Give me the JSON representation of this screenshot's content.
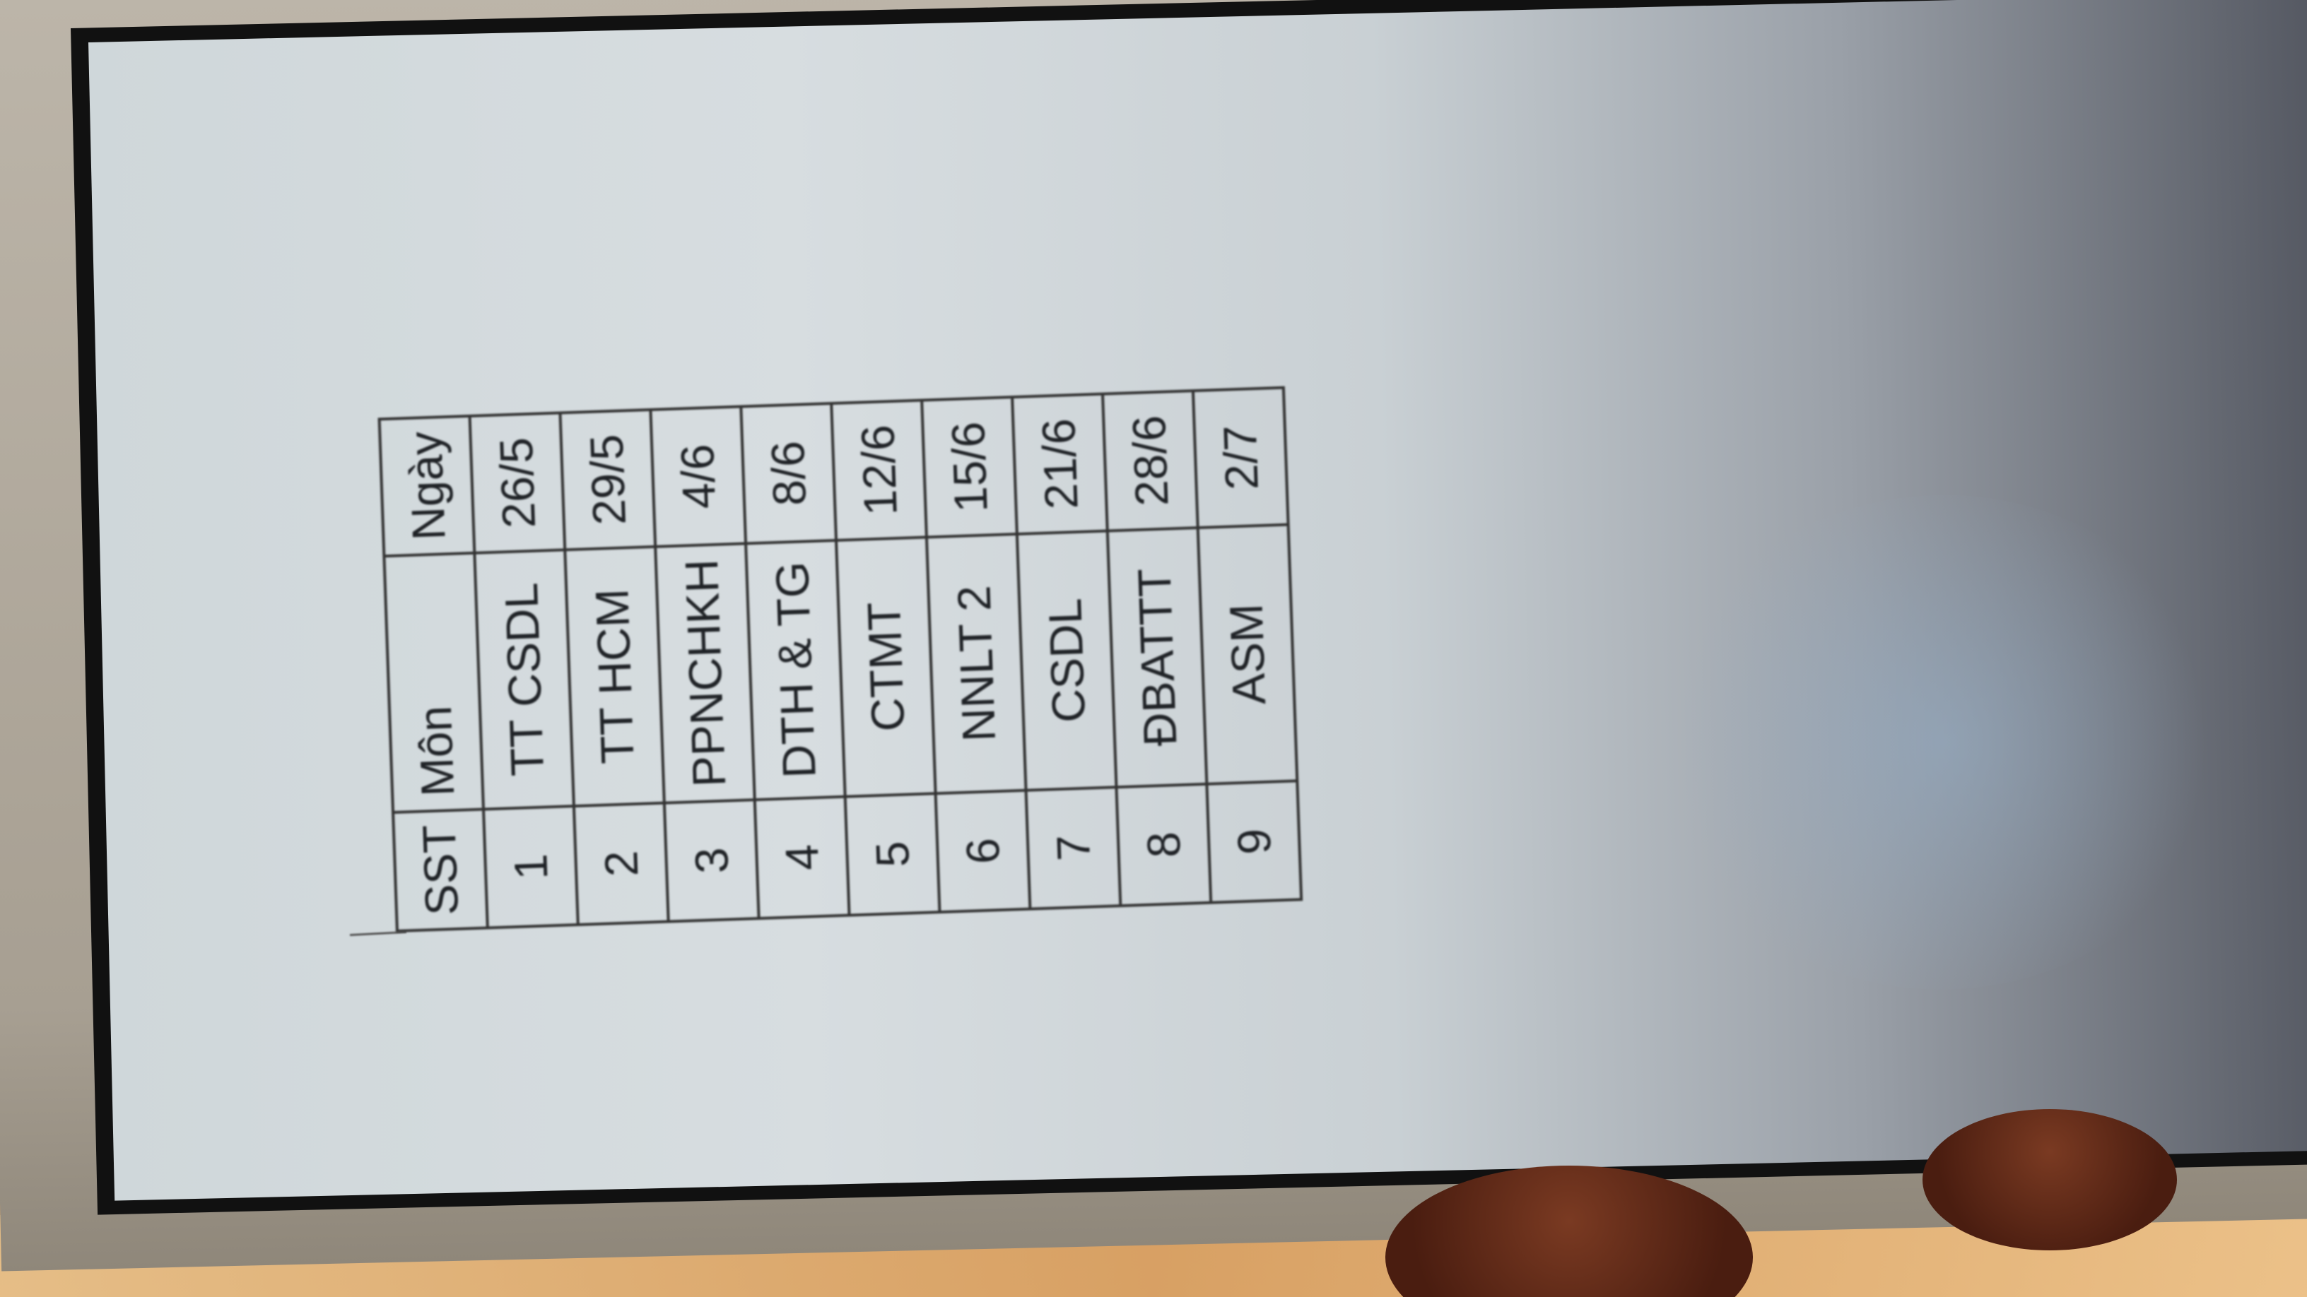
{
  "table": {
    "headers": [
      "SST",
      "Môn",
      "Ngày"
    ],
    "rows": [
      [
        "1",
        "TT CSDL",
        "26/5"
      ],
      [
        "2",
        "TT HCM",
        "29/5"
      ],
      [
        "3",
        "PPNCHKH",
        "4/6"
      ],
      [
        "4",
        "DTH & TG",
        "8/6"
      ],
      [
        "5",
        "CTMT",
        "12/6"
      ],
      [
        "6",
        "NNLT 2",
        "15/6"
      ],
      [
        "7",
        "CSDL",
        "21/6"
      ],
      [
        "8",
        "ĐBATTT",
        "28/6"
      ],
      [
        "9",
        "ASM",
        "2/7"
      ]
    ]
  }
}
